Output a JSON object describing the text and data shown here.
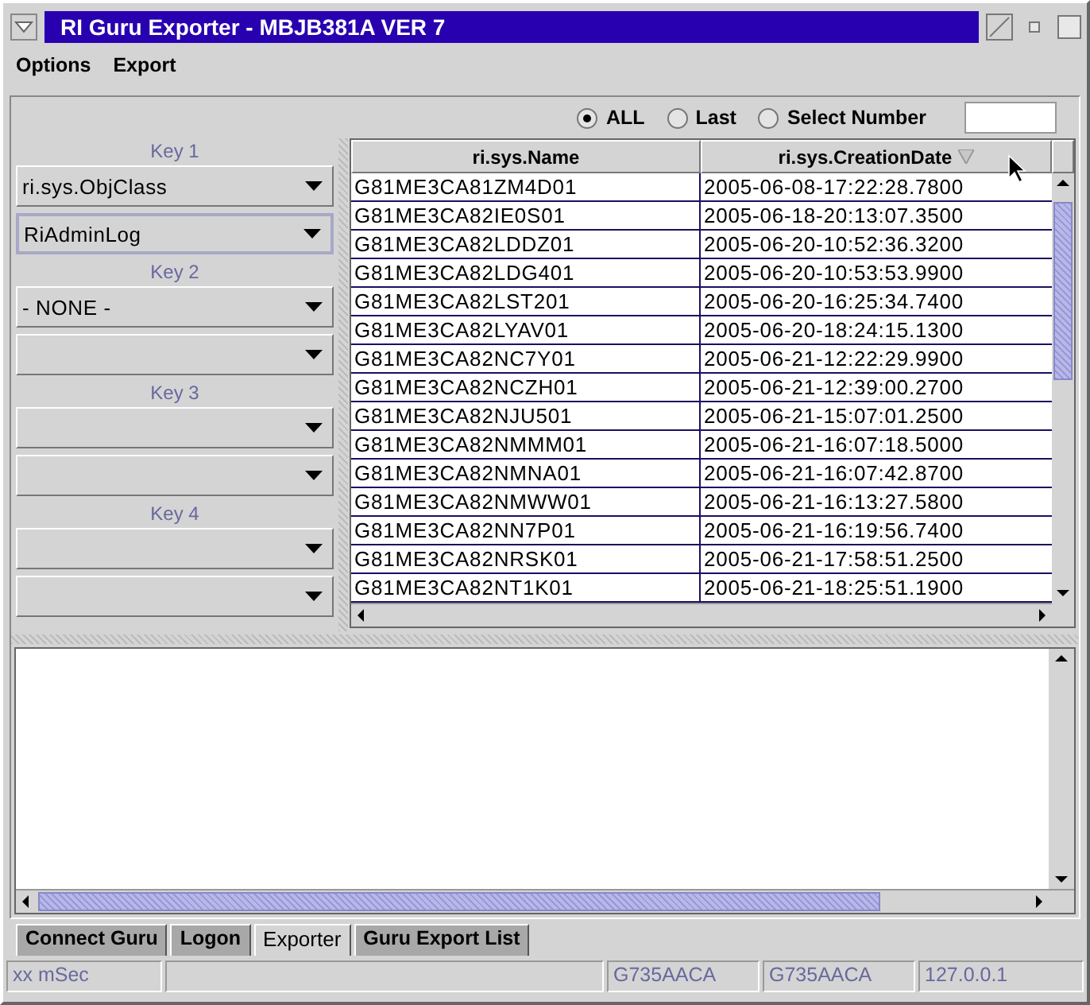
{
  "window": {
    "title": "RI Guru Exporter - MBJB381A  VER 7"
  },
  "menu": [
    "Options",
    "Export"
  ],
  "filter": {
    "options": [
      {
        "label": "ALL",
        "selected": true
      },
      {
        "label": "Last",
        "selected": false
      },
      {
        "label": "Select Number",
        "selected": false
      }
    ]
  },
  "keys": [
    {
      "label": "Key 1",
      "combos": [
        {
          "value": "ri.sys.ObjClass",
          "focused": false
        },
        {
          "value": "RiAdminLog",
          "focused": true
        }
      ]
    },
    {
      "label": "Key 2",
      "combos": [
        {
          "value": "- NONE -",
          "focused": false
        },
        {
          "focused": false
        }
      ]
    },
    {
      "label": "Key 3",
      "combos": [
        {
          "focused": false
        },
        {
          "focused": false
        }
      ]
    },
    {
      "label": "Key 4",
      "combos": [
        {
          "focused": false
        },
        {
          "focused": false
        }
      ]
    }
  ],
  "table": {
    "columns": [
      {
        "label": "ri.sys.Name",
        "sorted": false
      },
      {
        "label": "ri.sys.CreationDate",
        "sorted": true
      }
    ],
    "rows": [
      [
        "G81ME3CA81ZM4D01",
        "2005-06-08-17:22:28.7800"
      ],
      [
        "G81ME3CA82IE0S01",
        "2005-06-18-20:13:07.3500"
      ],
      [
        "G81ME3CA82LDDZ01",
        "2005-06-20-10:52:36.3200"
      ],
      [
        "G81ME3CA82LDG401",
        "2005-06-20-10:53:53.9900"
      ],
      [
        "G81ME3CA82LST201",
        "2005-06-20-16:25:34.7400"
      ],
      [
        "G81ME3CA82LYAV01",
        "2005-06-20-18:24:15.1300"
      ],
      [
        "G81ME3CA82NC7Y01",
        "2005-06-21-12:22:29.9900"
      ],
      [
        "G81ME3CA82NCZH01",
        "2005-06-21-12:39:00.2700"
      ],
      [
        "G81ME3CA82NJU501",
        "2005-06-21-15:07:01.2500"
      ],
      [
        "G81ME3CA82NMMM01",
        "2005-06-21-16:07:18.5000"
      ],
      [
        "G81ME3CA82NMNA01",
        "2005-06-21-16:07:42.8700"
      ],
      [
        "G81ME3CA82NMWW01",
        "2005-06-21-16:13:27.5800"
      ],
      [
        "G81ME3CA82NN7P01",
        "2005-06-21-16:19:56.7400"
      ],
      [
        "G81ME3CA82NRSK01",
        "2005-06-21-17:58:51.2500"
      ],
      [
        "G81ME3CA82NT1K01",
        "2005-06-21-18:25:51.1900"
      ]
    ]
  },
  "tabs": [
    {
      "label": "Connect Guru",
      "selected": false
    },
    {
      "label": "Logon",
      "selected": false
    },
    {
      "label": "Exporter",
      "selected": true
    },
    {
      "label": "Guru Export List",
      "selected": false
    }
  ],
  "status_bar": [
    "xx mSec",
    "G735AACA",
    "G735AACA",
    "127.0.0.1"
  ]
}
